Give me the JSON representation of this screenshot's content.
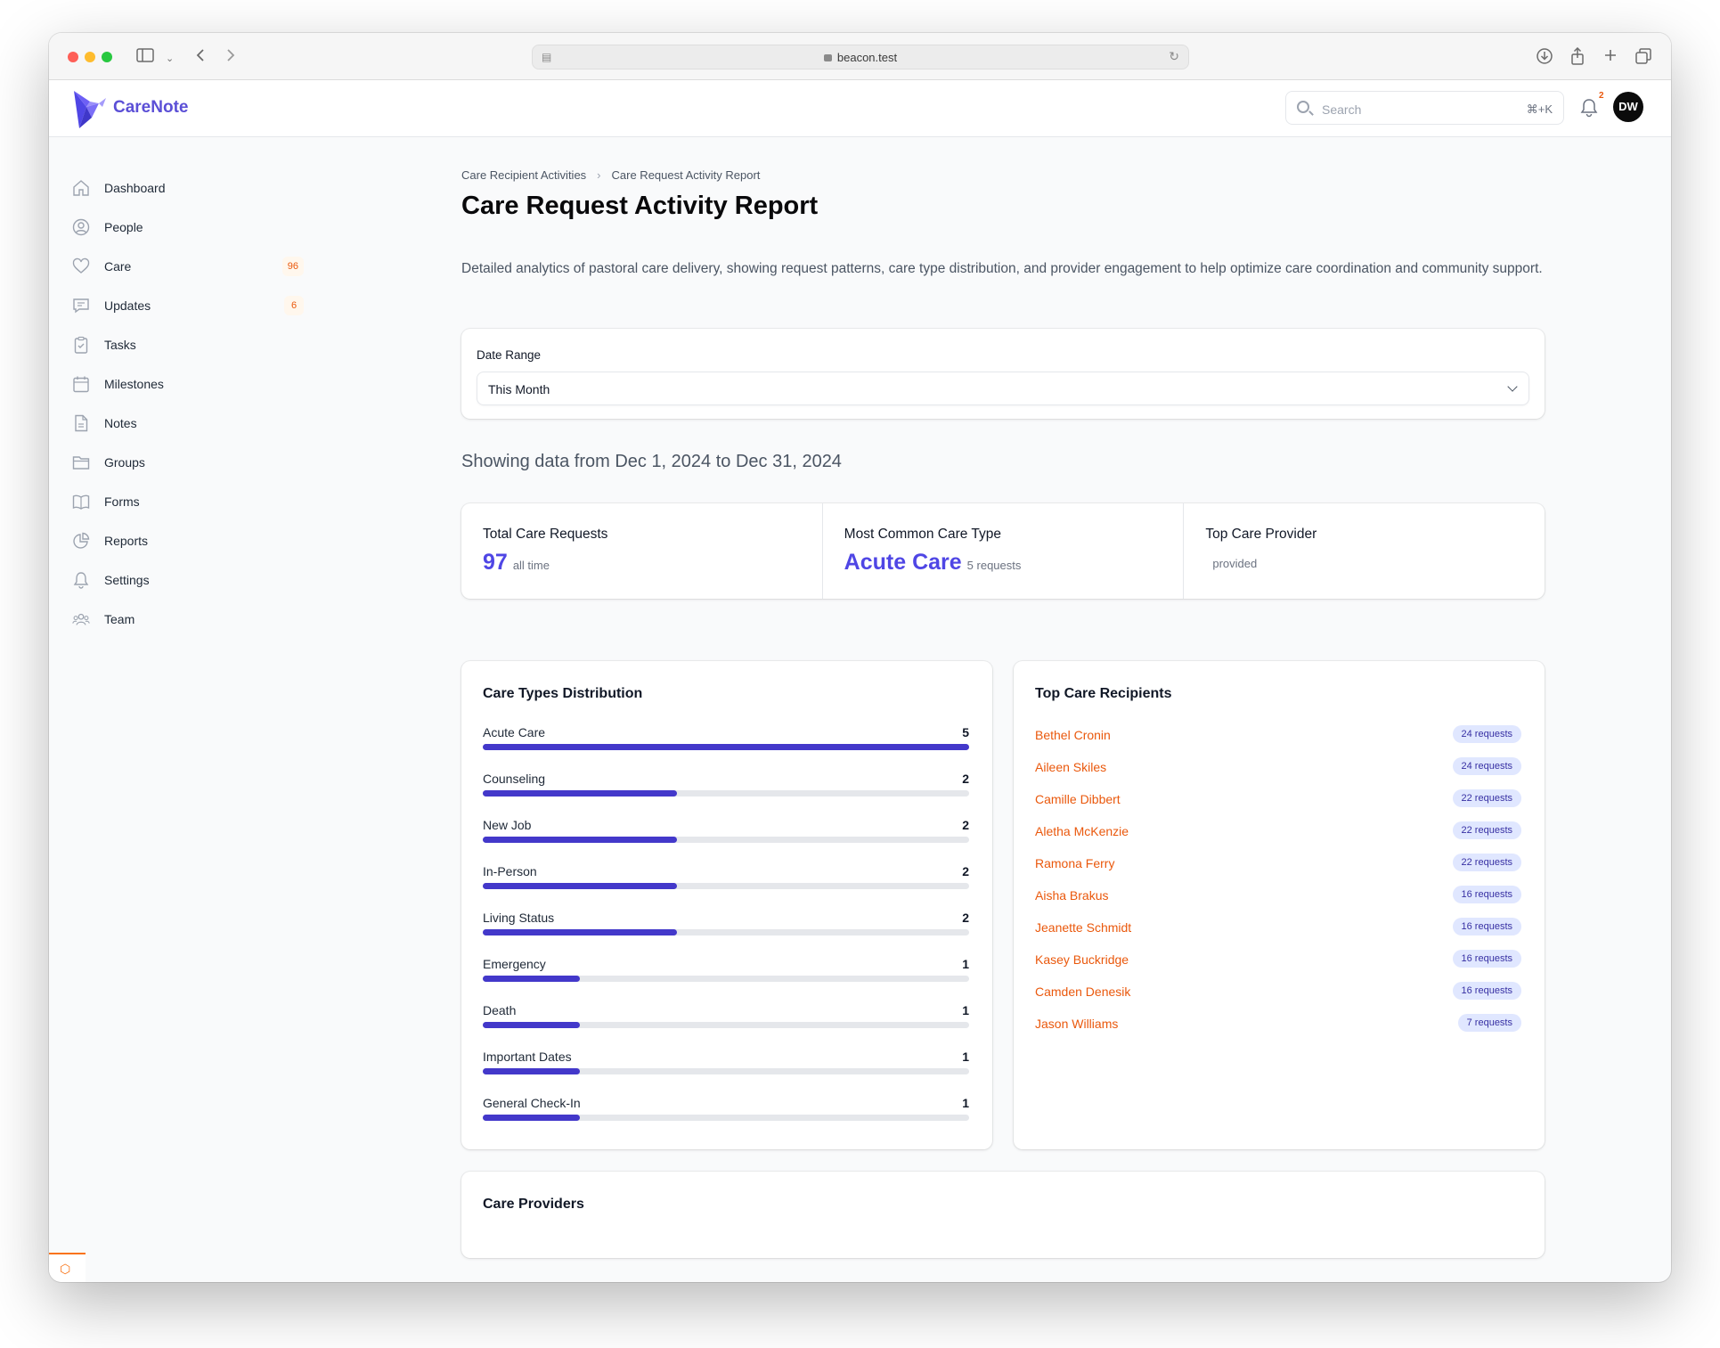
{
  "browser": {
    "url": "beacon.test"
  },
  "app": {
    "brand": "CareNote",
    "search_placeholder": "Search",
    "search_shortcut": "⌘+K",
    "notifications_count": "2",
    "user_initials": "DW"
  },
  "sidebar": {
    "items": [
      {
        "label": "Dashboard",
        "icon": "home-icon",
        "badge": ""
      },
      {
        "label": "People",
        "icon": "user-circle-icon",
        "badge": ""
      },
      {
        "label": "Care",
        "icon": "heart-icon",
        "badge": "96"
      },
      {
        "label": "Updates",
        "icon": "chat-icon",
        "badge": "6"
      },
      {
        "label": "Tasks",
        "icon": "clipboard-check-icon",
        "badge": ""
      },
      {
        "label": "Milestones",
        "icon": "calendar-icon",
        "badge": ""
      },
      {
        "label": "Notes",
        "icon": "document-icon",
        "badge": ""
      },
      {
        "label": "Groups",
        "icon": "folder-icon",
        "badge": ""
      },
      {
        "label": "Forms",
        "icon": "book-icon",
        "badge": ""
      },
      {
        "label": "Reports",
        "icon": "chart-pie-icon",
        "badge": ""
      },
      {
        "label": "Settings",
        "icon": "bell-icon",
        "badge": ""
      },
      {
        "label": "Team",
        "icon": "users-icon",
        "badge": ""
      }
    ]
  },
  "breadcrumb": {
    "parent": "Care Recipient Activities",
    "current": "Care Request Activity Report"
  },
  "page": {
    "title": "Care Request Activity Report",
    "description": "Detailed analytics of pastoral care delivery, showing request patterns, care type distribution, and provider engagement to help optimize care coordination and community support."
  },
  "filter": {
    "label": "Date Range",
    "value": "This Month"
  },
  "showing_text": "Showing data from Dec 1, 2024 to Dec 31, 2024",
  "stats": {
    "total": {
      "label": "Total Care Requests",
      "value": "97",
      "sub": "all time"
    },
    "common": {
      "label": "Most Common Care Type",
      "value": "Acute Care",
      "sub": "5 requests"
    },
    "provider": {
      "label": "Top Care Provider",
      "value": "",
      "sub": "provided"
    }
  },
  "distribution": {
    "title": "Care Types Distribution",
    "max": 5,
    "items": [
      {
        "name": "Acute Care",
        "count": 5
      },
      {
        "name": "Counseling",
        "count": 2
      },
      {
        "name": "New Job",
        "count": 2
      },
      {
        "name": "In-Person",
        "count": 2
      },
      {
        "name": "Living Status",
        "count": 2
      },
      {
        "name": "Emergency",
        "count": 1
      },
      {
        "name": "Death",
        "count": 1
      },
      {
        "name": "Important Dates",
        "count": 1
      },
      {
        "name": "General Check-In",
        "count": 1
      }
    ]
  },
  "recipients": {
    "title": "Top Care Recipients",
    "items": [
      {
        "name": "Bethel Cronin",
        "requests": "24 requests"
      },
      {
        "name": "Aileen Skiles",
        "requests": "24 requests"
      },
      {
        "name": "Camille Dibbert",
        "requests": "22 requests"
      },
      {
        "name": "Aletha McKenzie",
        "requests": "22 requests"
      },
      {
        "name": "Ramona Ferry",
        "requests": "22 requests"
      },
      {
        "name": "Aisha Brakus",
        "requests": "16 requests"
      },
      {
        "name": "Jeanette Schmidt",
        "requests": "16 requests"
      },
      {
        "name": "Kasey Buckridge",
        "requests": "16 requests"
      },
      {
        "name": "Camden Denesik",
        "requests": "16 requests"
      },
      {
        "name": "Jason Williams",
        "requests": "7 requests"
      }
    ]
  },
  "providers": {
    "title": "Care Providers"
  }
}
